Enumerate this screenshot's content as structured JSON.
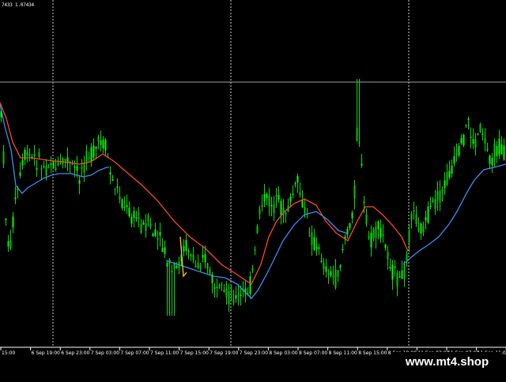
{
  "header": {
    "prices": "7433 1.07434"
  },
  "watermark": {
    "text": "www.mt4.shop"
  },
  "chart_data": {
    "type": "candlestick",
    "x_tick_labels": [
      "15:00",
      "6 Sep 19:00",
      "6 Sep 23:00",
      "7 Sep 03:00",
      "7 Sep 07:00",
      "7 Sep 11:00",
      "7 Sep 15:00",
      "7 Sep 19:00",
      "7 Sep 23:00",
      "8 Sep 03:00",
      "8 Sep 07:00",
      "8 Sep 11:00",
      "8 Sep 15:00",
      "8 Sep 19:00",
      "11 Sep 03:00",
      "11 Sep 07:00",
      "11 Sep 11:00",
      "11 Sep 15:00",
      "11 Sep 19:00",
      "11 Sep 23:00"
    ],
    "ylim": [
      0,
      480
    ],
    "highlight_level": 104,
    "period_separators": [
      "6 Sep 21:00",
      "7 Sep 21:00",
      "8 Sep 21:00"
    ],
    "price_path": [
      [
        0,
        130
      ],
      [
        4,
        200
      ],
      [
        8,
        300
      ],
      [
        12,
        320
      ],
      [
        16,
        280
      ],
      [
        20,
        250
      ],
      [
        24,
        230
      ],
      [
        28,
        210
      ],
      [
        32,
        195
      ],
      [
        36,
        200
      ],
      [
        40,
        200
      ],
      [
        44,
        205
      ],
      [
        48,
        200
      ],
      [
        52,
        210
      ],
      [
        56,
        212
      ],
      [
        60,
        210
      ],
      [
        64,
        205
      ],
      [
        68,
        210
      ],
      [
        72,
        215
      ],
      [
        76,
        210
      ],
      [
        80,
        205
      ],
      [
        84,
        200
      ],
      [
        88,
        210
      ],
      [
        92,
        212
      ],
      [
        96,
        215
      ],
      [
        100,
        225
      ],
      [
        104,
        210
      ],
      [
        108,
        200
      ],
      [
        112,
        195
      ],
      [
        116,
        200
      ],
      [
        120,
        190
      ],
      [
        124,
        182
      ],
      [
        128,
        180
      ],
      [
        132,
        185
      ],
      [
        136,
        200
      ],
      [
        140,
        225
      ],
      [
        144,
        235
      ],
      [
        148,
        240
      ],
      [
        152,
        250
      ],
      [
        156,
        260
      ],
      [
        160,
        265
      ],
      [
        164,
        270
      ],
      [
        168,
        275
      ],
      [
        172,
        275
      ],
      [
        176,
        280
      ],
      [
        180,
        290
      ],
      [
        184,
        285
      ],
      [
        188,
        280
      ],
      [
        192,
        295
      ],
      [
        196,
        300
      ],
      [
        200,
        305
      ],
      [
        204,
        310
      ],
      [
        208,
        320
      ],
      [
        212,
        335
      ],
      [
        216,
        345
      ],
      [
        220,
        345
      ],
      [
        224,
        340
      ],
      [
        228,
        330
      ],
      [
        232,
        315
      ],
      [
        236,
        310
      ],
      [
        240,
        320
      ],
      [
        244,
        330
      ],
      [
        248,
        340
      ],
      [
        252,
        330
      ],
      [
        256,
        320
      ],
      [
        260,
        330
      ],
      [
        264,
        345
      ],
      [
        268,
        355
      ],
      [
        272,
        365
      ],
      [
        276,
        372
      ],
      [
        280,
        375
      ],
      [
        284,
        375
      ],
      [
        288,
        375
      ],
      [
        292,
        372
      ],
      [
        296,
        375
      ],
      [
        300,
        378
      ],
      [
        304,
        375
      ],
      [
        308,
        372
      ],
      [
        312,
        370
      ],
      [
        316,
        360
      ],
      [
        320,
        340
      ],
      [
        324,
        300
      ],
      [
        328,
        270
      ],
      [
        332,
        255
      ],
      [
        336,
        250
      ],
      [
        340,
        255
      ],
      [
        344,
        260
      ],
      [
        348,
        262
      ],
      [
        352,
        260
      ],
      [
        356,
        265
      ],
      [
        360,
        270
      ],
      [
        364,
        265
      ],
      [
        368,
        250
      ],
      [
        372,
        240
      ],
      [
        376,
        230
      ],
      [
        380,
        250
      ],
      [
        384,
        265
      ],
      [
        388,
        280
      ],
      [
        392,
        295
      ],
      [
        396,
        305
      ],
      [
        400,
        315
      ],
      [
        404,
        320
      ],
      [
        408,
        330
      ],
      [
        412,
        340
      ],
      [
        416,
        345
      ],
      [
        420,
        350
      ],
      [
        424,
        355
      ],
      [
        428,
        345
      ],
      [
        432,
        320
      ],
      [
        436,
        300
      ],
      [
        440,
        295
      ],
      [
        444,
        280
      ],
      [
        448,
        240
      ],
      [
        452,
        150
      ],
      [
        456,
        200
      ],
      [
        460,
        260
      ],
      [
        464,
        295
      ],
      [
        468,
        305
      ],
      [
        472,
        300
      ],
      [
        476,
        295
      ],
      [
        480,
        290
      ],
      [
        484,
        300
      ],
      [
        488,
        315
      ],
      [
        492,
        325
      ],
      [
        496,
        345
      ],
      [
        500,
        350
      ],
      [
        504,
        355
      ],
      [
        508,
        350
      ],
      [
        512,
        340
      ],
      [
        516,
        300
      ],
      [
        520,
        275
      ],
      [
        524,
        270
      ],
      [
        528,
        280
      ],
      [
        532,
        290
      ],
      [
        536,
        285
      ],
      [
        540,
        275
      ],
      [
        544,
        270
      ],
      [
        548,
        260
      ],
      [
        552,
        255
      ],
      [
        556,
        250
      ],
      [
        560,
        240
      ],
      [
        564,
        230
      ],
      [
        568,
        220
      ],
      [
        572,
        210
      ],
      [
        576,
        205
      ],
      [
        580,
        195
      ],
      [
        584,
        185
      ],
      [
        588,
        165
      ],
      [
        592,
        150
      ],
      [
        596,
        175
      ],
      [
        600,
        185
      ],
      [
        604,
        170
      ],
      [
        608,
        160
      ],
      [
        612,
        175
      ],
      [
        616,
        190
      ],
      [
        620,
        200
      ],
      [
        624,
        195
      ],
      [
        628,
        190
      ],
      [
        632,
        185
      ],
      [
        636,
        195
      ],
      [
        640,
        200
      ]
    ],
    "ma_slow_path": [
      [
        0,
        130
      ],
      [
        8,
        150
      ],
      [
        16,
        180
      ],
      [
        26,
        200
      ],
      [
        40,
        200
      ],
      [
        60,
        203
      ],
      [
        80,
        205
      ],
      [
        100,
        208
      ],
      [
        115,
        205
      ],
      [
        130,
        195
      ],
      [
        145,
        205
      ],
      [
        160,
        218
      ],
      [
        180,
        235
      ],
      [
        200,
        255
      ],
      [
        220,
        280
      ],
      [
        240,
        300
      ],
      [
        260,
        315
      ],
      [
        280,
        335
      ],
      [
        300,
        348
      ],
      [
        318,
        360
      ],
      [
        330,
        335
      ],
      [
        340,
        300
      ],
      [
        350,
        280
      ],
      [
        360,
        268
      ],
      [
        372,
        258
      ],
      [
        385,
        252
      ],
      [
        400,
        260
      ],
      [
        412,
        280
      ],
      [
        425,
        295
      ],
      [
        440,
        305
      ],
      [
        452,
        280
      ],
      [
        462,
        262
      ],
      [
        472,
        262
      ],
      [
        484,
        272
      ],
      [
        496,
        285
      ],
      [
        508,
        300
      ],
      [
        516,
        318
      ]
    ],
    "ma_fast_path": [
      [
        0,
        132
      ],
      [
        6,
        160
      ],
      [
        14,
        190
      ],
      [
        20,
        235
      ],
      [
        28,
        245
      ],
      [
        35,
        238
      ],
      [
        45,
        232
      ],
      [
        55,
        226
      ],
      [
        65,
        222
      ],
      [
        75,
        220
      ],
      [
        90,
        220
      ],
      [
        105,
        224
      ],
      [
        115,
        222
      ],
      [
        125,
        216
      ],
      [
        135,
        212
      ],
      [
        138,
        212
      ]
    ],
    "ma_fast_path_2": [
      [
        210,
        330
      ],
      [
        225,
        335
      ],
      [
        240,
        340
      ],
      [
        255,
        345
      ],
      [
        270,
        350
      ],
      [
        285,
        352
      ],
      [
        300,
        360
      ],
      [
        310,
        370
      ],
      [
        318,
        378
      ],
      [
        326,
        368
      ],
      [
        336,
        350
      ],
      [
        346,
        330
      ],
      [
        358,
        305
      ],
      [
        372,
        285
      ],
      [
        385,
        272
      ],
      [
        400,
        268
      ],
      [
        414,
        278
      ],
      [
        428,
        292
      ],
      [
        440,
        296
      ]
    ],
    "ma_fast_path_3": [
      [
        510,
        335
      ],
      [
        520,
        326
      ],
      [
        530,
        318
      ],
      [
        542,
        310
      ],
      [
        555,
        300
      ],
      [
        568,
        284
      ],
      [
        578,
        268
      ],
      [
        590,
        245
      ],
      [
        600,
        228
      ],
      [
        612,
        215
      ],
      [
        625,
        212
      ],
      [
        640,
        208
      ]
    ],
    "ma_signal_path": [
      [
        228,
        300
      ],
      [
        232,
        350
      ],
      [
        236,
        345
      ]
    ]
  }
}
